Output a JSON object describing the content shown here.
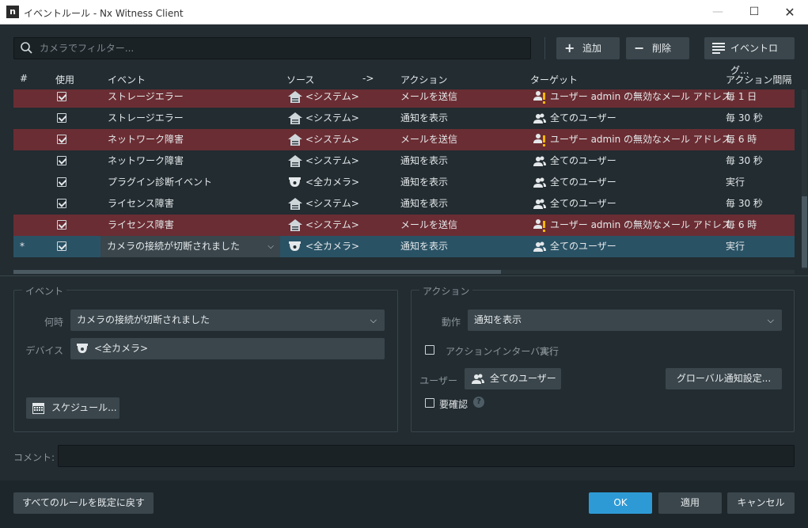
{
  "window": {
    "logo": "n",
    "title": "イベントルール - Nx Witness Client",
    "min": "—",
    "max": "☐",
    "close": "✕"
  },
  "toolbar": {
    "filter_placeholder": "カメラでフィルター...",
    "add_label": "追加",
    "delete_label": "削除",
    "log_label": "イベントログ..."
  },
  "table": {
    "headers": {
      "num": "#",
      "use": "使用",
      "event": "イベント",
      "source": "ソース",
      "arrow": "->",
      "action": "アクション",
      "target": "ターゲット",
      "interval": "アクション間隔"
    },
    "rows": [
      {
        "num": "",
        "event": "ストレージエラー",
        "source": "<システム>",
        "source_icon": "server-icon",
        "action": "メールを送信",
        "target": "ユーザー admin の無効なメール アドレス",
        "target_icon": "user-warning-icon",
        "interval": "毎 1 日",
        "error": true,
        "selected": false
      },
      {
        "num": "",
        "event": "ストレージエラー",
        "source": "<システム>",
        "source_icon": "server-icon",
        "action": "通知を表示",
        "target": "全てのユーザー",
        "target_icon": "users-icon",
        "interval": "毎 30 秒",
        "error": false,
        "selected": false
      },
      {
        "num": "",
        "event": "ネットワーク障害",
        "source": "<システム>",
        "source_icon": "server-icon",
        "action": "メールを送信",
        "target": "ユーザー admin の無効なメール アドレス",
        "target_icon": "user-warning-icon",
        "interval": "毎 6 時",
        "error": true,
        "selected": false
      },
      {
        "num": "",
        "event": "ネットワーク障害",
        "source": "<システム>",
        "source_icon": "server-icon",
        "action": "通知を表示",
        "target": "全てのユーザー",
        "target_icon": "users-icon",
        "interval": "毎 30 秒",
        "error": false,
        "selected": false
      },
      {
        "num": "",
        "event": "プラグイン診断イベント",
        "source": "<全カメラ>",
        "source_icon": "camera-icon",
        "action": "通知を表示",
        "target": "全てのユーザー",
        "target_icon": "users-icon",
        "interval": "実行",
        "error": false,
        "selected": false
      },
      {
        "num": "",
        "event": "ライセンス障害",
        "source": "<システム>",
        "source_icon": "server-icon",
        "action": "通知を表示",
        "target": "全てのユーザー",
        "target_icon": "users-icon",
        "interval": "毎 30 秒",
        "error": false,
        "selected": false
      },
      {
        "num": "",
        "event": "ライセンス障害",
        "source": "<システム>",
        "source_icon": "server-icon",
        "action": "メールを送信",
        "target": "ユーザー admin の無効なメール アドレス",
        "target_icon": "user-warning-icon",
        "interval": "毎 6 時",
        "error": true,
        "selected": false
      },
      {
        "num": "*",
        "event": "カメラの接続が切断されました",
        "source": "<全カメラ>",
        "source_icon": "camera-icon",
        "action": "通知を表示",
        "target": "全てのユーザー",
        "target_icon": "users-icon",
        "interval": "実行",
        "error": false,
        "selected": true
      }
    ]
  },
  "event_panel": {
    "title": "イベント",
    "when_label": "何時",
    "when_value": "カメラの接続が切断されました",
    "device_label": "デバイス",
    "device_value": "<全カメラ>",
    "schedule_label": "スケジュール..."
  },
  "action_panel": {
    "title": "アクション",
    "do_label": "動作",
    "do_value": "通知を表示",
    "interval_label": "アクションインターバル:",
    "interval_value": "実行",
    "user_label": "ユーザー",
    "user_value": "全てのユーザー",
    "global_label": "グローバル通知設定...",
    "confirm_label": "要確認",
    "help": "?"
  },
  "comment_label": "コメント:",
  "footer": {
    "reset_label": "すべてのルールを既定に戻す",
    "ok_label": "OK",
    "apply_label": "適用",
    "cancel_label": "キャンセル"
  },
  "colors": {
    "background": "#222c31",
    "error_row": "#6a2d33",
    "selected_row": "#2a5265",
    "primary": "#2d9ad6",
    "warning": "#f5b800"
  }
}
